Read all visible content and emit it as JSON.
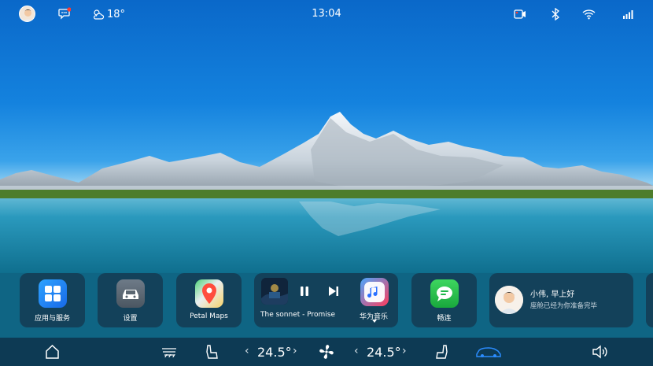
{
  "status": {
    "temperature": "18°",
    "time": "13:04"
  },
  "dock": {
    "apps": [
      {
        "label": "应用与服务"
      },
      {
        "label": "设置"
      },
      {
        "label": "Petal Maps"
      }
    ],
    "music": {
      "song": "The sonnet - Promise",
      "app_label": "华为音乐"
    },
    "changlian_label": "畅连",
    "greeting": {
      "name": "小伟,   早上好",
      "message": "座舱已经为你准备完毕"
    }
  },
  "bottom": {
    "left_temp": "24.5°",
    "right_temp": "24.5°"
  },
  "colors": {
    "accent": "#2b8cff",
    "dock_bg": "#14374e",
    "bottom_bg": "#0d3a54",
    "music_red": "#ff3b5c",
    "maps_red": "#ff4d3d",
    "changlian_green": "#1fb84a"
  }
}
